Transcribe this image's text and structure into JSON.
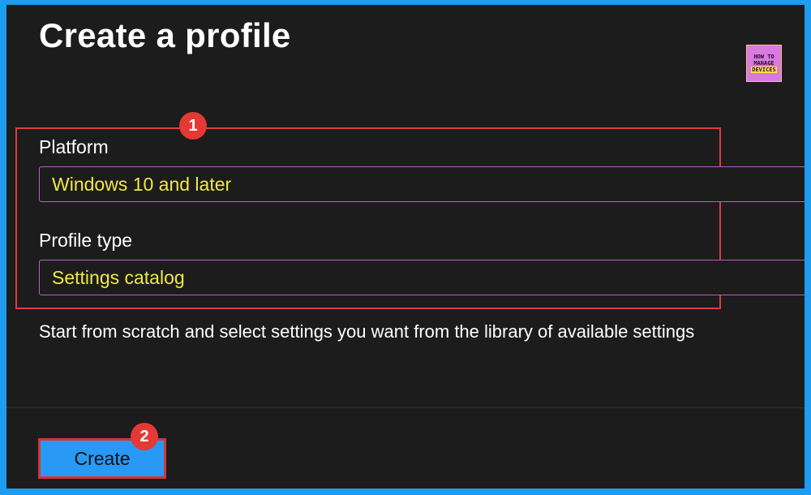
{
  "page": {
    "title": "Create a profile"
  },
  "logo": {
    "line1": "HOW TO",
    "line2": "MANAGE",
    "line3": "DEVICES"
  },
  "form": {
    "platform": {
      "label": "Platform",
      "value": "Windows 10 and later"
    },
    "profile_type": {
      "label": "Profile type",
      "value": "Settings catalog"
    },
    "description": "Start from scratch and select settings you want from the library of available settings"
  },
  "annotations": {
    "badge_1": "1",
    "badge_2": "2"
  },
  "actions": {
    "create_label": "Create"
  },
  "colors": {
    "frame_border": "#1f9bf0",
    "background": "#1c1c1c",
    "highlight": "#e03c3c",
    "select_value": "#f0e84a",
    "select_border": "#b760c4",
    "button": "#2899f5"
  }
}
